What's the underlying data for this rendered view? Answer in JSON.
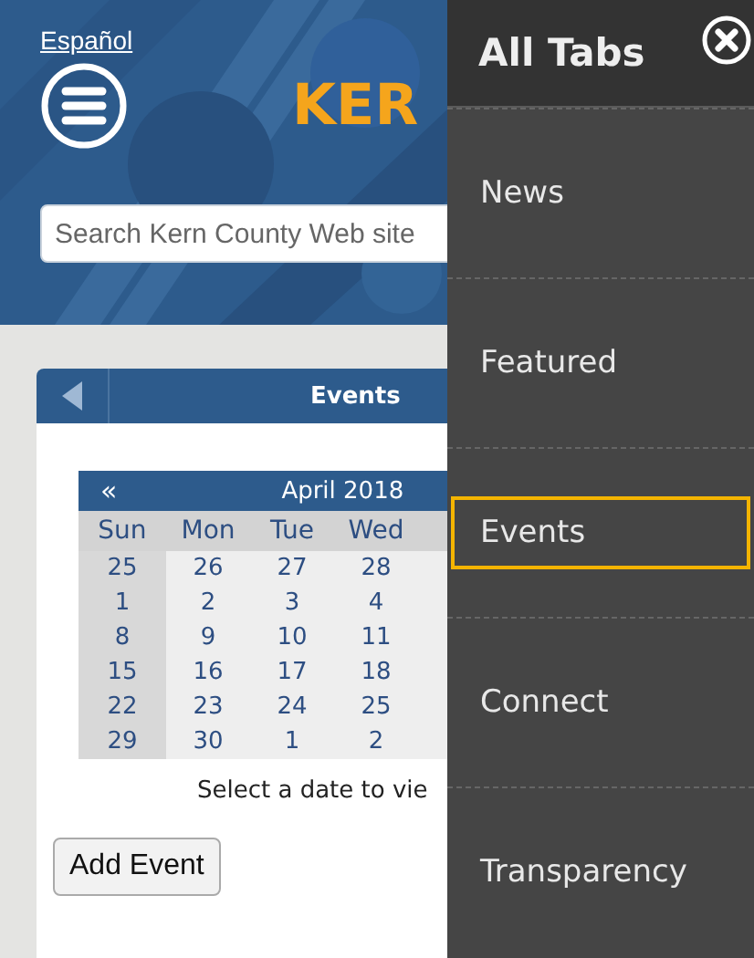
{
  "language_link": "Español",
  "logo_text": "KER",
  "search": {
    "placeholder": "Search Kern County Web site"
  },
  "events_panel": {
    "title": "Events",
    "calendar": {
      "prev_button": "«",
      "month": "April 2018",
      "weekdays": [
        "Sun",
        "Mon",
        "Tue",
        "Wed"
      ],
      "weeks": [
        [
          "25",
          "26",
          "27",
          "28"
        ],
        [
          "1",
          "2",
          "3",
          "4"
        ],
        [
          "8",
          "9",
          "10",
          "11"
        ],
        [
          "15",
          "16",
          "17",
          "18"
        ],
        [
          "22",
          "23",
          "24",
          "25"
        ],
        [
          "29",
          "30",
          "1",
          "2"
        ]
      ]
    },
    "hint": "Select a date to vie",
    "add_button": "Add Event"
  },
  "drawer": {
    "title": "All Tabs",
    "items": [
      {
        "label": "News",
        "selected": false
      },
      {
        "label": "Featured",
        "selected": false
      },
      {
        "label": "Events",
        "selected": true
      },
      {
        "label": "Connect",
        "selected": false
      },
      {
        "label": "Transparency",
        "selected": false
      }
    ]
  }
}
